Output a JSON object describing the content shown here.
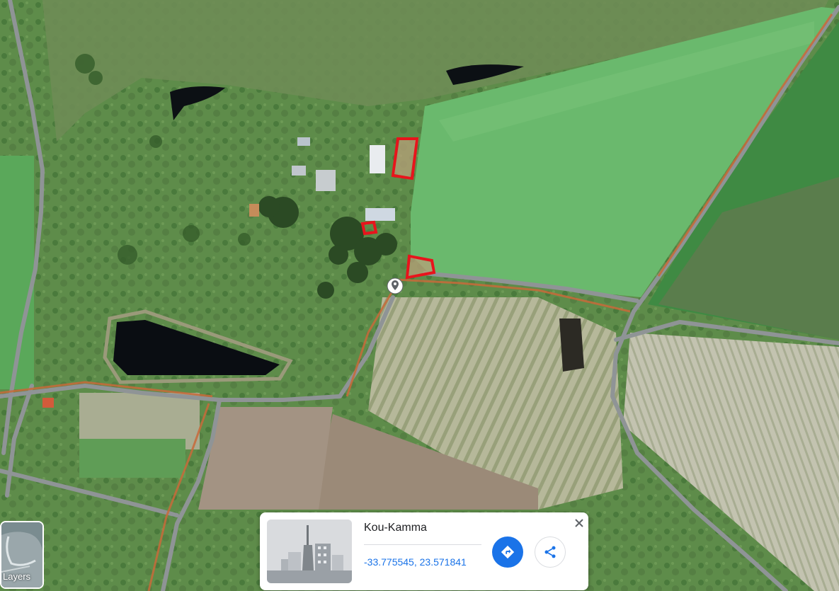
{
  "place": {
    "name": "Kou-Kamma",
    "coordinates": "-33.775545, 23.571841"
  },
  "layers": {
    "label": "Layers"
  },
  "icons": {
    "directions": "directions-icon",
    "share": "share-icon",
    "close": "close-icon",
    "pin": "location-pin-icon",
    "layers": "layers-icon"
  },
  "colors": {
    "accent": "#1a73e8",
    "marked_area": "#e8141c",
    "road": "#8a8f91",
    "dirt_road": "#c86a3a"
  }
}
